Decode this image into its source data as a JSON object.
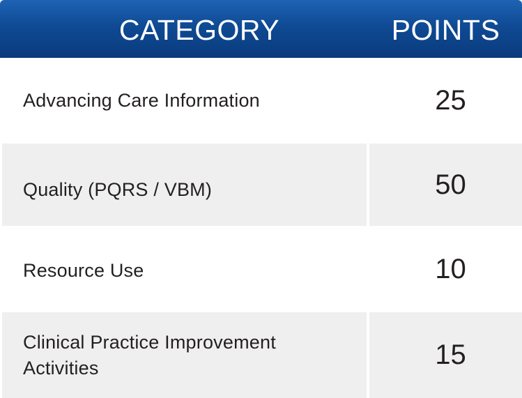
{
  "header": {
    "category_label": "CATEGORY",
    "points_label": "POINTS"
  },
  "rows": [
    {
      "category": "Advancing Care Information",
      "points": "25"
    },
    {
      "category": "Quality (PQRS / VBM)",
      "points": "50"
    },
    {
      "category": "Resource Use",
      "points": "10"
    },
    {
      "category": "Clinical Practice Improvement Activities",
      "points": "15"
    }
  ],
  "colors": {
    "header_top": "#1e63b4",
    "header_bottom": "#0a3b7c",
    "row_alt": "#efefef",
    "text": "#231f20"
  }
}
